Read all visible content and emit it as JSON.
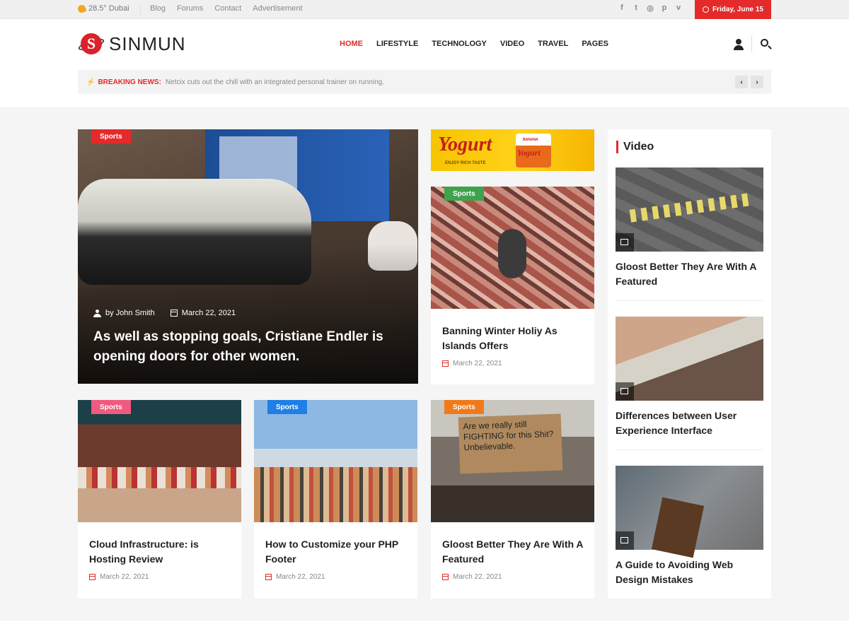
{
  "topbar": {
    "weather": "28.5° Dubai",
    "links": [
      "Blog",
      "Forums",
      "Contact",
      "Advertisement"
    ],
    "socials": [
      "f",
      "t",
      "◎",
      "p",
      "v"
    ],
    "date": "Friday, June 15"
  },
  "header": {
    "logo_text": "SINMUN",
    "logo_letter": "S",
    "nav": [
      "HOME",
      "LIFESTYLE",
      "TECHNOLOGY",
      "VIDEO",
      "TRAVEL",
      "PAGES"
    ],
    "active_nav": "HOME"
  },
  "breaking": {
    "label": "BREAKING NEWS:",
    "text": "Netcix cuts out the chill with an integrated personal trainer on running.",
    "prev": "‹",
    "next": "›"
  },
  "hero": {
    "tag": "Sports",
    "tag_color": "#e42a2a",
    "author": "by John Smith",
    "date": "March 22, 2021",
    "title": "As well as stopping goals, Cristiane Endler is opening doors for other women."
  },
  "ad": {
    "brand": "Yogurt",
    "cup_label": "Yogurt",
    "flavor": "BANANA",
    "tagline": "ENJOY RICH TASTE"
  },
  "cards": [
    {
      "tag": "Sports",
      "tag_color": "#3fa34d",
      "title": "Banning Winter Holiy As Islands Offers",
      "date": "March 22, 2021"
    },
    {
      "tag": "Sports",
      "tag_color": "#f05a7e",
      "title": "Cloud Infrastructure: is Hosting Review",
      "date": "March 22, 2021"
    },
    {
      "tag": "Sports",
      "tag_color": "#1e7fe6",
      "title": "How to Customize your PHP Footer",
      "date": "March 22, 2021"
    },
    {
      "tag": "Sports",
      "tag_color": "#f07a1a",
      "title": "Gloost Better They Are With A Featured",
      "date": "March 22, 2021",
      "sign": "Are we really still FIGHTING for this Shit? Unbelievable."
    }
  ],
  "sidebar": {
    "heading": "Video",
    "items": [
      {
        "title": "Gloost Better They Are With A Featured"
      },
      {
        "title": "Differences between User Experience Interface"
      },
      {
        "title": "A Guide to Avoiding Web Design Mistakes"
      }
    ]
  },
  "colors": {
    "accent": "#e42a2a",
    "background": "#f4f5f4"
  }
}
